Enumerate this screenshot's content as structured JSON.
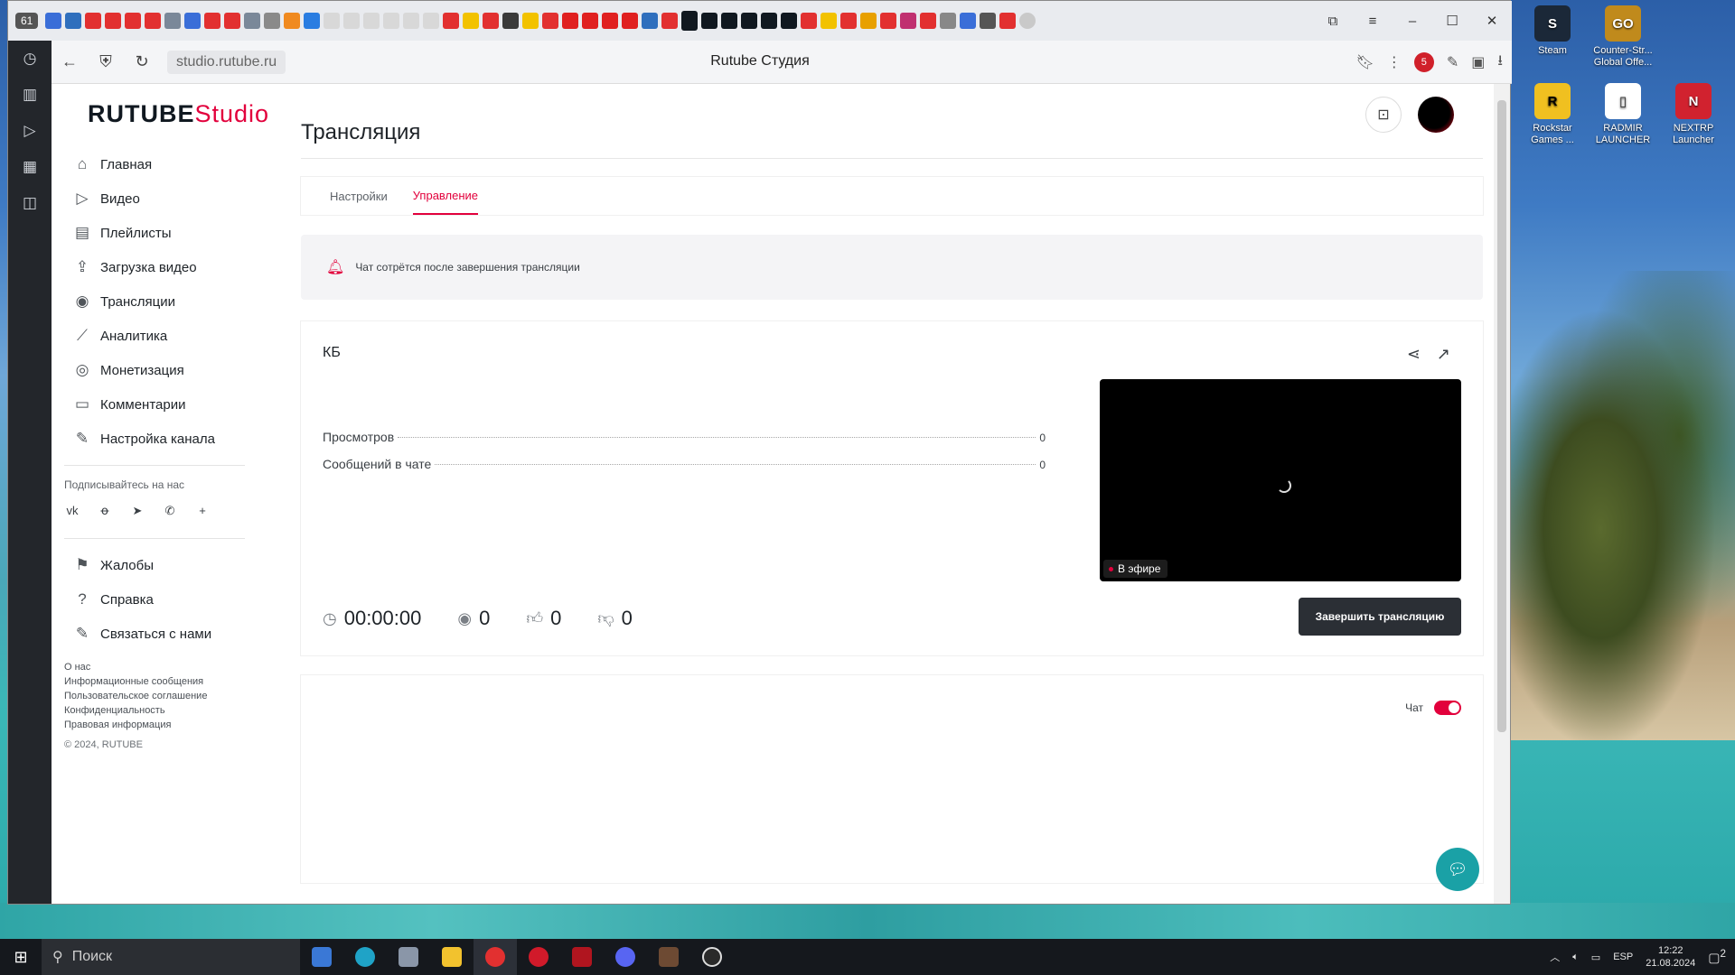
{
  "desktop": {
    "icons": [
      {
        "label": "Steam",
        "color": "#1b2838"
      },
      {
        "label": "Counter-Str... Global Offe...",
        "color": "#c08a1c"
      },
      {
        "label": "Rockstar Games ...",
        "color": "#f0c020"
      },
      {
        "label": "RADMIR LAUNCHER",
        "color": "#ffffff"
      },
      {
        "label": "NEXTRP Launcher",
        "color": "#d1222f"
      }
    ]
  },
  "browser": {
    "tab_count": "61",
    "url": "studio.rutube.ru",
    "page_title": "Rutube Студия",
    "extension_badge": "5"
  },
  "site": {
    "logo_brand": "RUTUBE",
    "logo_studio": "Studio"
  },
  "sidebar": {
    "items": [
      {
        "label": "Главная",
        "icon": "home-icon",
        "glyph": "⌂"
      },
      {
        "label": "Видео",
        "icon": "video-icon",
        "glyph": "▷"
      },
      {
        "label": "Плейлисты",
        "icon": "playlist-icon",
        "glyph": "▤"
      },
      {
        "label": "Загрузка видео",
        "icon": "upload-icon",
        "glyph": "⇪"
      },
      {
        "label": "Трансляции",
        "icon": "broadcast-icon",
        "glyph": "◉"
      },
      {
        "label": "Аналитика",
        "icon": "analytics-icon",
        "glyph": "⟋"
      },
      {
        "label": "Монетизация",
        "icon": "monetization-icon",
        "glyph": "◎"
      },
      {
        "label": "Комментарии",
        "icon": "comments-icon",
        "glyph": "▭"
      },
      {
        "label": "Настройка канала",
        "icon": "channel-settings-icon",
        "glyph": "✎"
      }
    ],
    "follow_title": "Подписывайтесь на нас",
    "socials": [
      "vk",
      "ok",
      "telegram",
      "viber",
      "more"
    ],
    "secondary": [
      {
        "label": "Жалобы",
        "icon": "flag-icon",
        "glyph": "⚑"
      },
      {
        "label": "Справка",
        "icon": "help-icon",
        "glyph": "?"
      },
      {
        "label": "Связаться с нами",
        "icon": "contact-icon",
        "glyph": "✎"
      }
    ],
    "footer_links": [
      "О нас",
      "Информационные сообщения",
      "Пользовательское соглашение",
      "Конфиденциальность",
      "Правовая информация"
    ],
    "copyright": "© 2024, RUTUBE"
  },
  "main": {
    "title": "Трансляция",
    "tabs": [
      {
        "label": "Настройки",
        "active": false
      },
      {
        "label": "Управление",
        "active": true
      }
    ],
    "notice": "Чат сотрётся после завершения трансляции",
    "stream": {
      "name": "КБ",
      "stats": [
        {
          "label": "Просмотров",
          "value": "0"
        },
        {
          "label": "Сообщений в чате",
          "value": "0"
        }
      ],
      "timer": "00:00:00",
      "viewers": "0",
      "likes": "0",
      "dislikes": "0",
      "live_label": "В эфире",
      "end_button": "Завершить трансляцию"
    },
    "chat": {
      "label": "Чат",
      "enabled": true
    }
  },
  "taskbar": {
    "search_placeholder": "Поиск",
    "lang": "ESP",
    "time": "12:22",
    "date": "21.08.2024",
    "notifications": "2"
  }
}
